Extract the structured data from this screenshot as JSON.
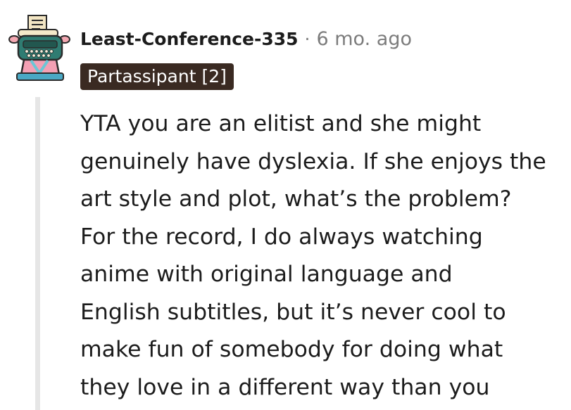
{
  "comment": {
    "author": "Least-Conference-335",
    "separator": "·",
    "timestamp": "6 mo. ago",
    "flair": "Partassipant [2]",
    "avatar_icon": "typewriter-avatar-icon",
    "body_lines": [
      "YTA you are an elitist and she might",
      "genuinely have dyslexia. If she enjoys the",
      "art style and plot, what’s the problem?",
      "For the record, I do always watching",
      "anime with original language and",
      "English subtitles, but it’s never cool to",
      "make fun of somebody for doing what",
      "they love in a different way than you"
    ]
  },
  "colors": {
    "flair_background": "#3a2a22",
    "thread_line": "#e6e6e6",
    "meta_text": "#7c7c7c",
    "body_text": "#1c1c1c"
  }
}
